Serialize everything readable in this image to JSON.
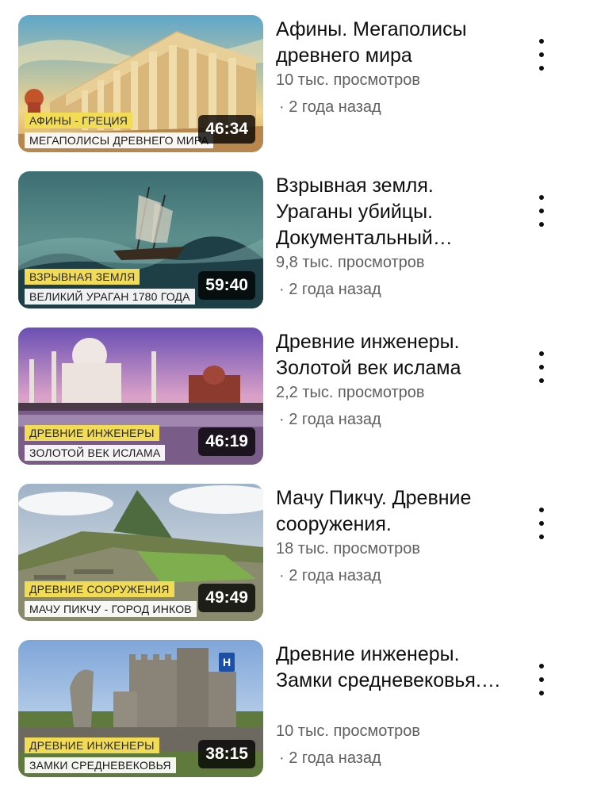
{
  "videos": [
    {
      "title": "Афины. Мегаполисы древнего мира",
      "views": "10 тыс. просмотров",
      "age": "· 2 года назад",
      "duration": "46:34",
      "thumb_tag1": "АФИНЫ - ГРЕЦИЯ",
      "thumb_tag2": "МЕГАПОЛИСЫ ДРЕВНЕГО МИРА"
    },
    {
      "title": "Взрывная земля. Ураганы убийцы. Документальный…",
      "views": "9,8 тыс. просмотров",
      "age": "· 2 года назад",
      "duration": "59:40",
      "thumb_tag1": "ВЗРЫВНАЯ ЗЕМЛЯ",
      "thumb_tag2": "ВЕЛИКИЙ УРАГАН 1780 ГОДА"
    },
    {
      "title": "Древние инженеры. Золотой век ислама",
      "views": "2,2 тыс. просмотров",
      "age": "· 2 года назад",
      "duration": "46:19",
      "thumb_tag1": "ДРЕВНИЕ ИНЖЕНЕРЫ",
      "thumb_tag2": "ЗОЛОТОЙ ВЕК ИСЛАМА"
    },
    {
      "title": "Мачу Пикчу. Древние сооружения.",
      "views": "18 тыс. просмотров",
      "age": "· 2 года назад",
      "duration": "49:49",
      "thumb_tag1": "ДРЕВНИЕ СООРУЖЕНИЯ",
      "thumb_tag2": "МАЧУ ПИКЧУ - ГОРОД ИНКОВ"
    },
    {
      "title": "Древние инженеры. Замки средневековья.…",
      "views": "10 тыс. просмотров",
      "age": "· 2 года назад",
      "duration": "38:15",
      "thumb_tag1": "ДРЕВНИЕ ИНЖЕНЕРЫ",
      "thumb_tag2": "ЗАМКИ СРЕДНЕВЕКОВЬЯ",
      "channel_badge": "H"
    }
  ],
  "icons": {
    "menu": "more-vertical-icon"
  }
}
